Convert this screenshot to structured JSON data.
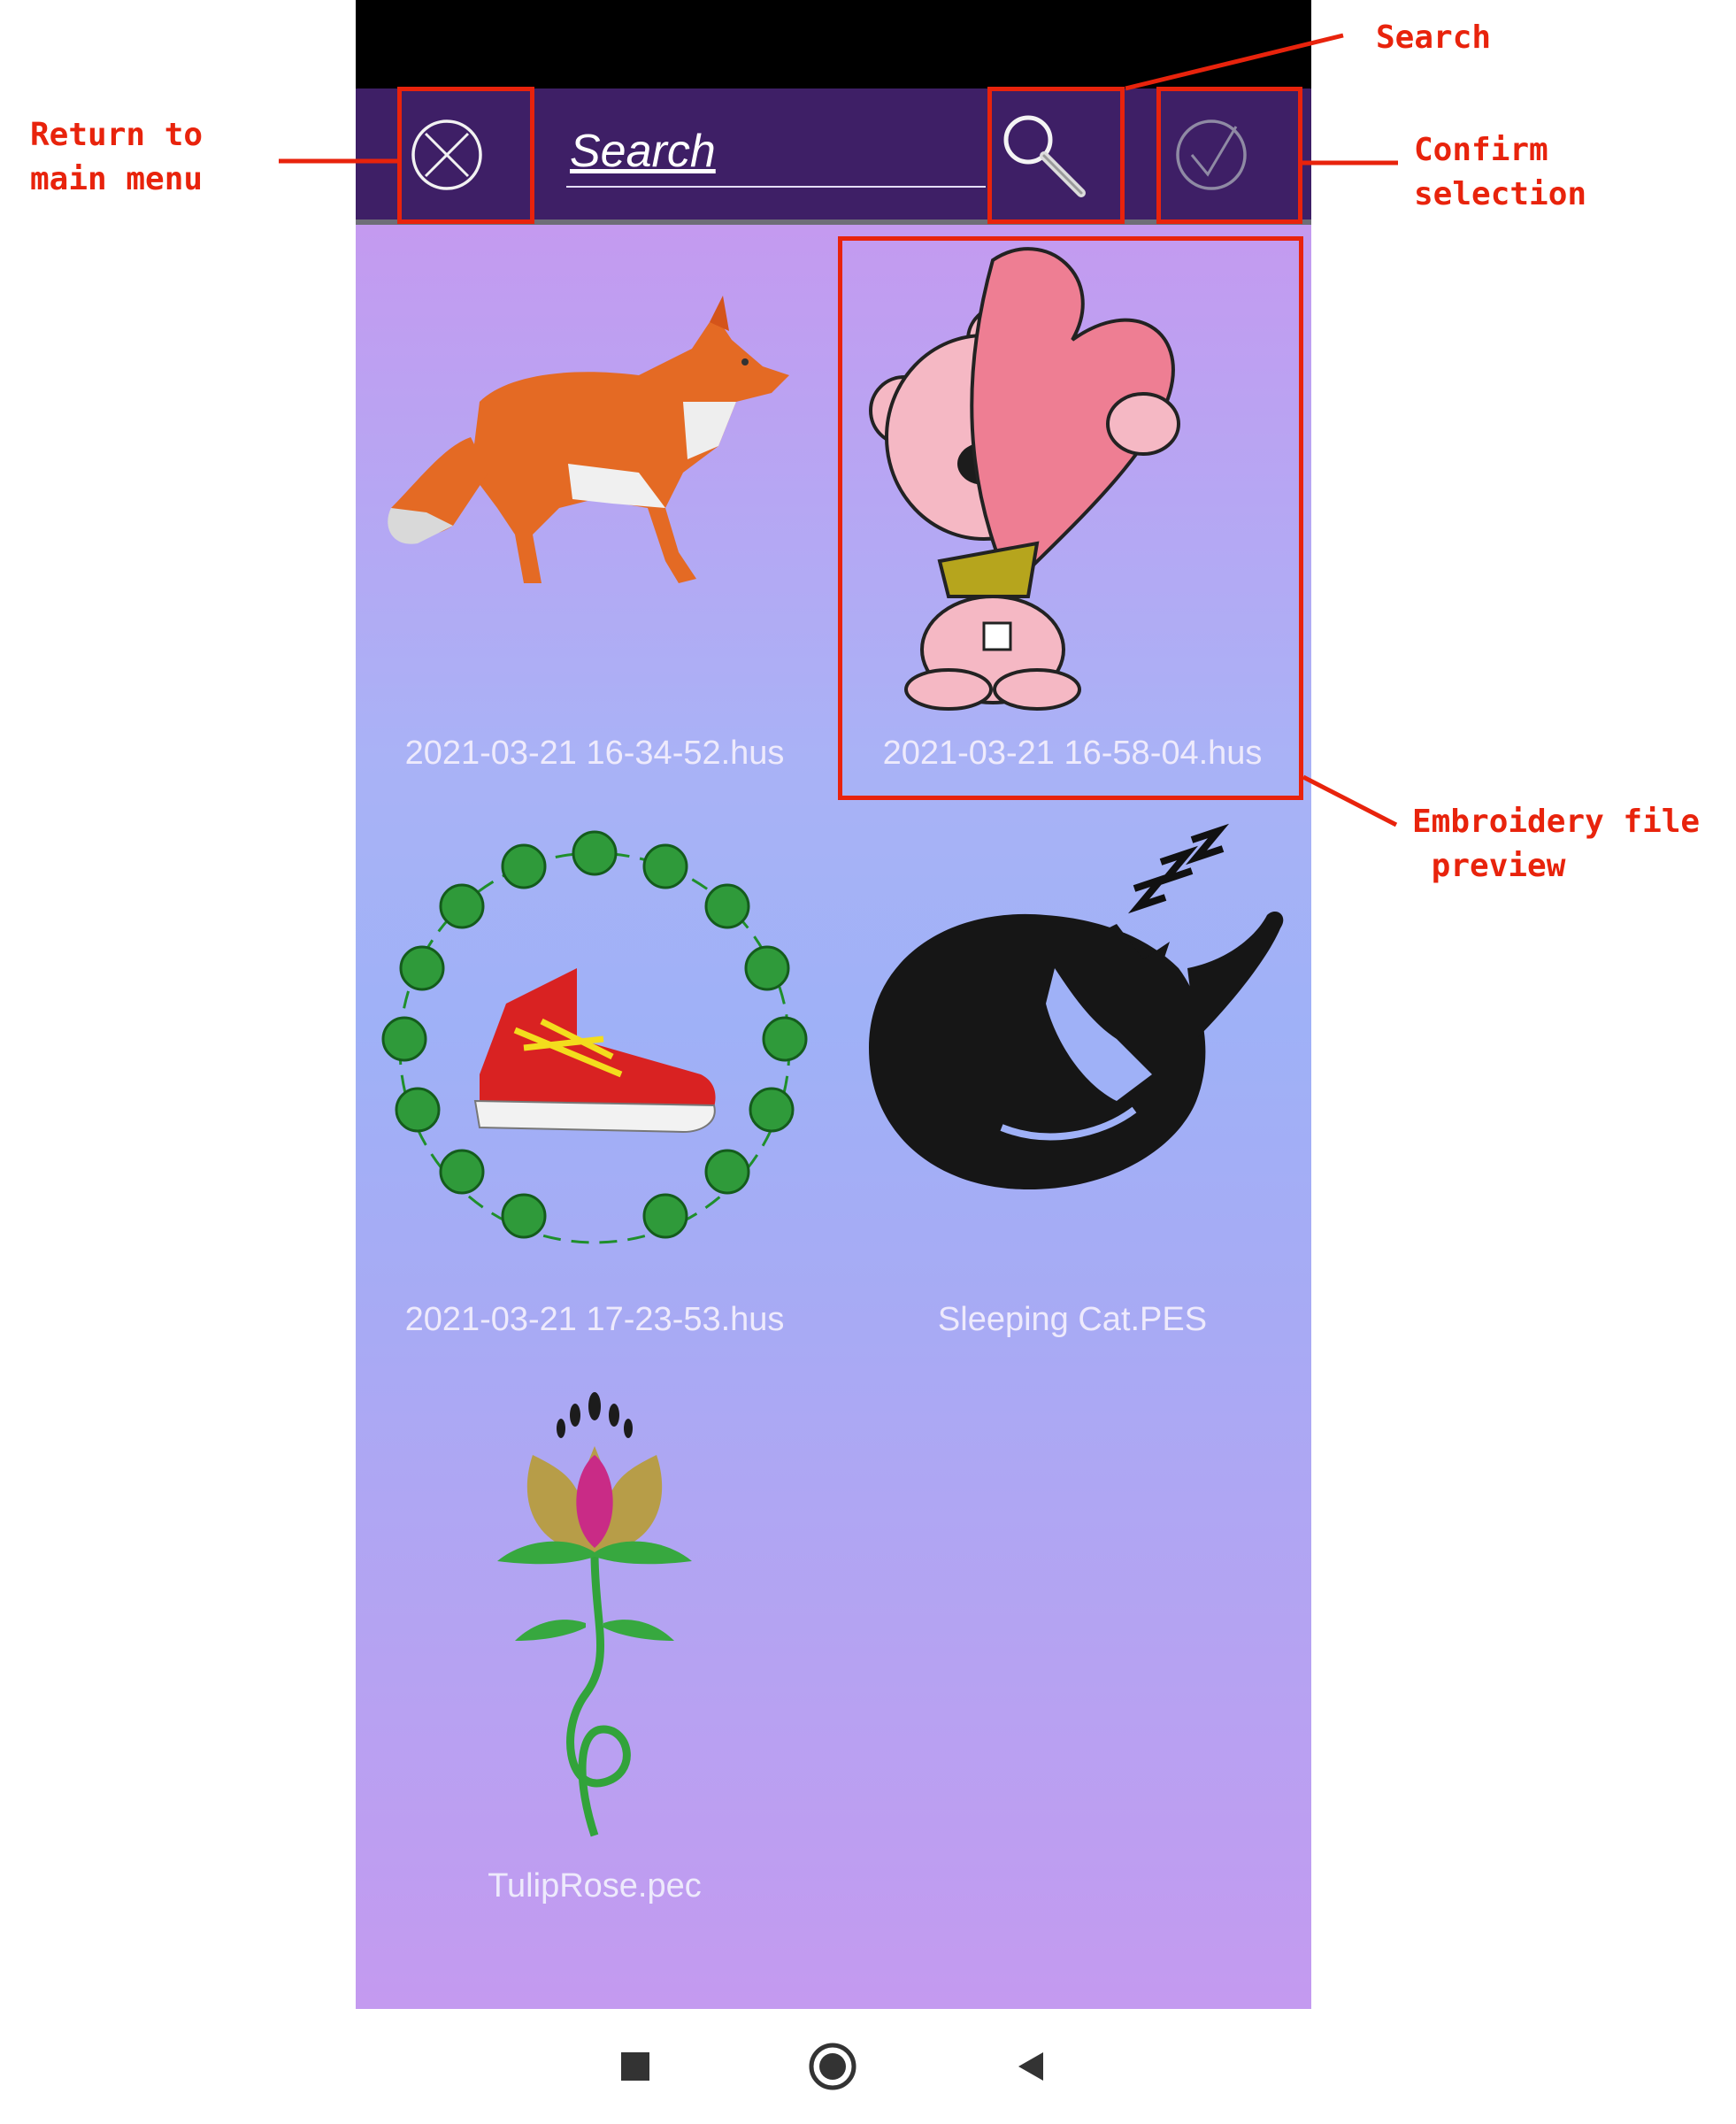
{
  "toolbar": {
    "search_placeholder": "Search",
    "close_icon": "circle-x-icon",
    "search_icon": "magnifier-icon",
    "confirm_icon": "circle-check-icon",
    "background_color": "#3e1f66"
  },
  "files": [
    {
      "name": "2021-03-21 16-34-52.hus",
      "icon": "fox-embroidery"
    },
    {
      "name": "2021-03-21 16-58-04.hus",
      "icon": "teddy-bear-heart-embroidery"
    },
    {
      "name": "2021-03-21 17-23-53.hus",
      "icon": "sneaker-wreath-embroidery"
    },
    {
      "name": "Sleeping Cat.PES",
      "icon": "sleeping-cat-embroidery"
    },
    {
      "name": "TulipRose.pec",
      "icon": "tulip-rose-embroidery"
    }
  ],
  "annotations": {
    "return_menu": "Return to\nmain menu",
    "search": "Search",
    "confirm": "Confirm\nselection",
    "preview": "Embroidery file\n preview"
  },
  "navbar": {
    "recents_icon": "square-icon",
    "home_icon": "circle-icon",
    "back_icon": "triangle-back-icon"
  },
  "colors": {
    "annotation": "#e8230c",
    "gradient_top": "#c49af0",
    "gradient_mid": "#9fb1f7"
  }
}
